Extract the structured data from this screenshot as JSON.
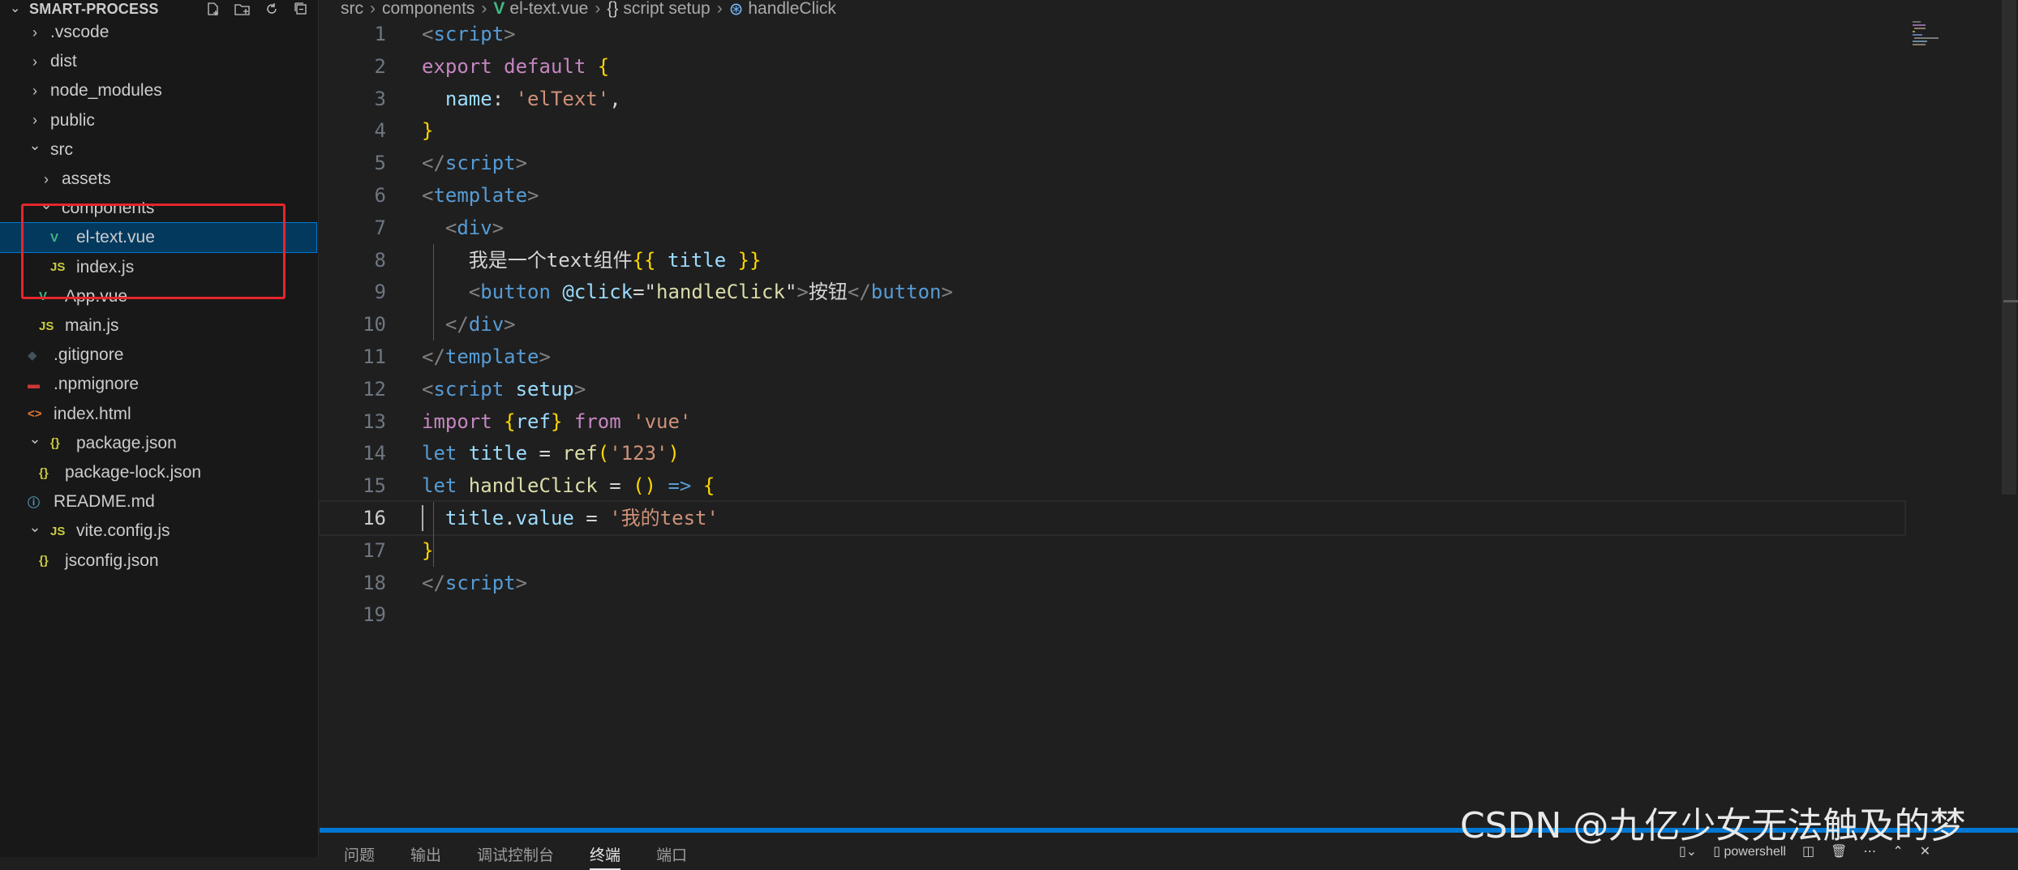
{
  "explorer": {
    "title": "SMART-PROCESS",
    "actions": [
      "new-file-icon",
      "new-folder-icon",
      "refresh-icon",
      "collapse-all-icon"
    ],
    "items": [
      {
        "label": ".vscode",
        "chevron": "right",
        "icon": "",
        "depth": 0
      },
      {
        "label": "dist",
        "chevron": "right",
        "icon": "",
        "depth": 0
      },
      {
        "label": "node_modules",
        "chevron": "right",
        "icon": "",
        "depth": 0
      },
      {
        "label": "public",
        "chevron": "right",
        "icon": "",
        "depth": 0
      },
      {
        "label": "src",
        "chevron": "down",
        "icon": "",
        "depth": 0
      },
      {
        "label": "assets",
        "chevron": "right",
        "icon": "",
        "depth": 1
      },
      {
        "label": "components",
        "chevron": "down",
        "icon": "",
        "depth": 1
      },
      {
        "label": "el-text.vue",
        "chevron": "",
        "icon": "vue",
        "depth": 2,
        "selected": true
      },
      {
        "label": "index.js",
        "chevron": "",
        "icon": "js",
        "depth": 2
      },
      {
        "label": "App.vue",
        "chevron": "",
        "icon": "vue",
        "depth": 1
      },
      {
        "label": "main.js",
        "chevron": "",
        "icon": "js",
        "depth": 1
      },
      {
        "label": ".gitignore",
        "chevron": "",
        "icon": "git",
        "depth": 0
      },
      {
        "label": ".npmignore",
        "chevron": "",
        "icon": "npm",
        "depth": 0
      },
      {
        "label": "index.html",
        "chevron": "",
        "icon": "html",
        "depth": 0
      },
      {
        "label": "package.json",
        "chevron": "down",
        "icon": "json",
        "depth": 0
      },
      {
        "label": "package-lock.json",
        "chevron": "",
        "icon": "json",
        "depth": 1
      },
      {
        "label": "README.md",
        "chevron": "",
        "icon": "info",
        "depth": 0
      },
      {
        "label": "vite.config.js",
        "chevron": "down",
        "icon": "js",
        "depth": 0
      },
      {
        "label": "jsconfig.json",
        "chevron": "",
        "icon": "json",
        "depth": 1
      }
    ]
  },
  "breadcrumb": [
    {
      "label": "src",
      "icon": ""
    },
    {
      "label": "components",
      "icon": ""
    },
    {
      "label": "el-text.vue",
      "icon": "vue"
    },
    {
      "label": "script setup",
      "icon": "braces"
    },
    {
      "label": "handleClick",
      "icon": "symbol"
    }
  ],
  "editor": {
    "current_line": 16,
    "lines": [
      [
        {
          "t": "<",
          "c": "t-tag"
        },
        {
          "t": "script",
          "c": "t-tagname"
        },
        {
          "t": ">",
          "c": "t-tag"
        }
      ],
      [
        {
          "t": "export ",
          "c": "t-kw"
        },
        {
          "t": "default ",
          "c": "t-kw"
        },
        {
          "t": "{",
          "c": "t-br1"
        }
      ],
      [
        {
          "t": "  ",
          "c": "t-plain"
        },
        {
          "t": "name",
          "c": "t-var"
        },
        {
          "t": ": ",
          "c": "t-plain"
        },
        {
          "t": "'elText'",
          "c": "t-str"
        },
        {
          "t": ",",
          "c": "t-plain"
        }
      ],
      [
        {
          "t": "}",
          "c": "t-br1"
        }
      ],
      [
        {
          "t": "</",
          "c": "t-tag"
        },
        {
          "t": "script",
          "c": "t-tagname"
        },
        {
          "t": ">",
          "c": "t-tag"
        }
      ],
      [
        {
          "t": "<",
          "c": "t-tag"
        },
        {
          "t": "template",
          "c": "t-tagname"
        },
        {
          "t": ">",
          "c": "t-tag"
        }
      ],
      [
        {
          "t": "  ",
          "c": "t-plain"
        },
        {
          "t": "<",
          "c": "t-tag"
        },
        {
          "t": "div",
          "c": "t-tagname"
        },
        {
          "t": ">",
          "c": "t-tag"
        }
      ],
      [
        {
          "t": "    ",
          "c": "t-plain"
        },
        {
          "t": "我是一个text组件",
          "c": "t-plain"
        },
        {
          "t": "{{ ",
          "c": "t-br1"
        },
        {
          "t": "title",
          "c": "t-var"
        },
        {
          "t": " }}",
          "c": "t-br1"
        }
      ],
      [
        {
          "t": "    ",
          "c": "t-plain"
        },
        {
          "t": "<",
          "c": "t-tag"
        },
        {
          "t": "button ",
          "c": "t-tagname"
        },
        {
          "t": "@click",
          "c": "t-attr"
        },
        {
          "t": "=\"",
          "c": "t-plain"
        },
        {
          "t": "handleClick",
          "c": "t-func"
        },
        {
          "t": "\"",
          "c": "t-plain"
        },
        {
          "t": ">",
          "c": "t-tag"
        },
        {
          "t": "按钮",
          "c": "t-plain"
        },
        {
          "t": "</",
          "c": "t-tag"
        },
        {
          "t": "button",
          "c": "t-tagname"
        },
        {
          "t": ">",
          "c": "t-tag"
        }
      ],
      [
        {
          "t": "  ",
          "c": "t-plain"
        },
        {
          "t": "</",
          "c": "t-tag"
        },
        {
          "t": "div",
          "c": "t-tagname"
        },
        {
          "t": ">",
          "c": "t-tag"
        }
      ],
      [
        {
          "t": "</",
          "c": "t-tag"
        },
        {
          "t": "template",
          "c": "t-tagname"
        },
        {
          "t": ">",
          "c": "t-tag"
        }
      ],
      [
        {
          "t": "<",
          "c": "t-tag"
        },
        {
          "t": "script ",
          "c": "t-tagname"
        },
        {
          "t": "setup",
          "c": "t-attr"
        },
        {
          "t": ">",
          "c": "t-tag"
        }
      ],
      [
        {
          "t": "import ",
          "c": "t-kw"
        },
        {
          "t": "{",
          "c": "t-br1"
        },
        {
          "t": "ref",
          "c": "t-var"
        },
        {
          "t": "} ",
          "c": "t-br1"
        },
        {
          "t": "from ",
          "c": "t-kw"
        },
        {
          "t": "'vue'",
          "c": "t-str"
        }
      ],
      [
        {
          "t": "let ",
          "c": "t-kwb"
        },
        {
          "t": "title",
          "c": "t-var"
        },
        {
          "t": " = ",
          "c": "t-plain"
        },
        {
          "t": "ref",
          "c": "t-func"
        },
        {
          "t": "(",
          "c": "t-br1"
        },
        {
          "t": "'123'",
          "c": "t-str"
        },
        {
          "t": ")",
          "c": "t-br1"
        }
      ],
      [
        {
          "t": "let ",
          "c": "t-kwb"
        },
        {
          "t": "handleClick",
          "c": "t-func"
        },
        {
          "t": " = ",
          "c": "t-plain"
        },
        {
          "t": "()",
          "c": "t-br1"
        },
        {
          "t": " => ",
          "c": "t-kwb"
        },
        {
          "t": "{",
          "c": "t-br1"
        }
      ],
      [
        {
          "t": "  ",
          "c": "t-plain"
        },
        {
          "t": "title",
          "c": "t-var"
        },
        {
          "t": ".",
          "c": "t-plain"
        },
        {
          "t": "value",
          "c": "t-var"
        },
        {
          "t": " = ",
          "c": "t-plain"
        },
        {
          "t": "'我的test'",
          "c": "t-str"
        }
      ],
      [
        {
          "t": "}",
          "c": "t-br1"
        }
      ],
      [
        {
          "t": "</",
          "c": "t-tag"
        },
        {
          "t": "script",
          "c": "t-tagname"
        },
        {
          "t": ">",
          "c": "t-tag"
        }
      ],
      []
    ]
  },
  "panel": {
    "tabs": [
      "问题",
      "输出",
      "调试控制台",
      "终端",
      "端口"
    ],
    "active_tab": "终端",
    "terminal_name": "powershell"
  },
  "watermark": "CSDN @九亿少女无法触及的梦",
  "colors": {
    "selection": "#04395e",
    "highlight_box": "#e5262b",
    "panel_sash": "#0078d4",
    "vue_icon": "#41b883",
    "js_icon": "#cbcb41"
  }
}
